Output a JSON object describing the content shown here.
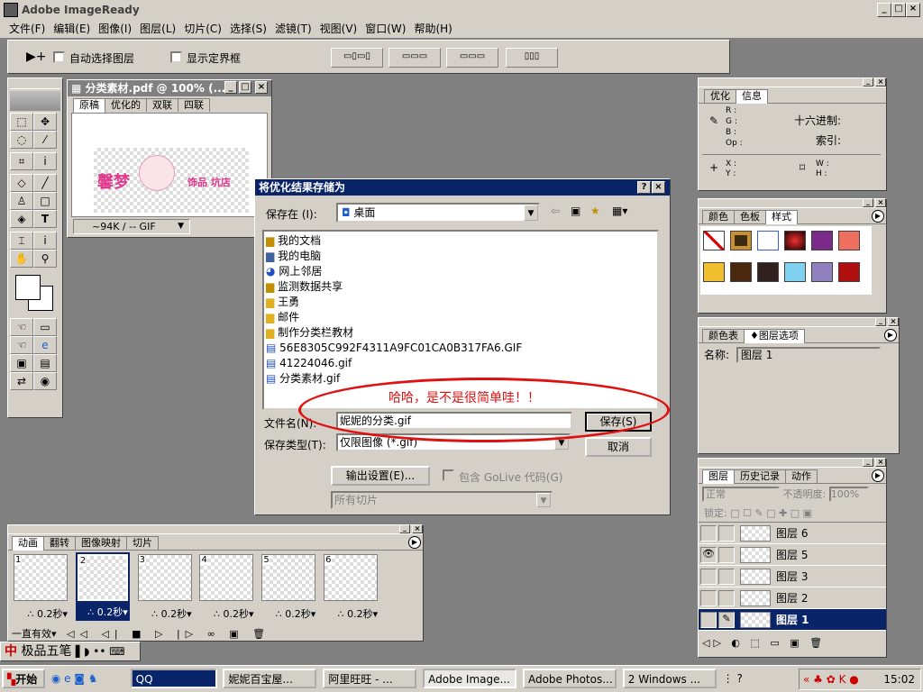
{
  "app": {
    "title": "Adobe ImageReady"
  },
  "menu": [
    "文件(F)",
    "编辑(E)",
    "图像(I)",
    "图层(L)",
    "切片(C)",
    "选择(S)",
    "滤镜(T)",
    "视图(V)",
    "窗口(W)",
    "帮助(H)"
  ],
  "options": {
    "auto_select": "自动选择图层",
    "show_bounds": "显示定界框"
  },
  "doc": {
    "title": "分类素材.pdf @ 100% (...",
    "tabs": [
      "原稿",
      "优化的",
      "双联",
      "四联"
    ],
    "status": "~94K / -- GIF",
    "logo_text": "馨梦",
    "logo_text2": "饰品 坑店"
  },
  "info_panel": {
    "tabs": [
      "优化",
      "信息"
    ],
    "hex_label": "十六进制:",
    "index_label": "索引:",
    "rgb": [
      "R :",
      "G :",
      "B :",
      "Op :"
    ],
    "xy": [
      "X :",
      "Y :"
    ],
    "wh": [
      "W :",
      "H :"
    ]
  },
  "color_panel": {
    "tabs": [
      "颜色",
      "色板",
      "样式"
    ]
  },
  "table_panel": {
    "tabs": [
      "颜色表",
      "图层选项"
    ],
    "name_label": "名称:",
    "name_value": "图层 1"
  },
  "layers_panel": {
    "tabs": [
      "图层",
      "历史记录",
      "动作"
    ],
    "blend": "正常",
    "opacity_label": "不透明度:",
    "opacity": "100%",
    "lock_label": "锁定:",
    "layers": [
      "图层 6",
      "图层 5",
      "图层 3",
      "图层 2",
      "图层 1"
    ]
  },
  "animation": {
    "tabs": [
      "动画",
      "翻转",
      "图像映射",
      "切片"
    ],
    "frames": [
      {
        "num": "1",
        "delay": "0.2秒"
      },
      {
        "num": "2",
        "delay": "0.2秒"
      },
      {
        "num": "3",
        "delay": "0.2秒"
      },
      {
        "num": "4",
        "delay": "0.2秒"
      },
      {
        "num": "5",
        "delay": "0.2秒"
      },
      {
        "num": "6",
        "delay": "0.2秒"
      }
    ],
    "loop": "一直有效"
  },
  "dialog": {
    "title": "将优化结果存储为",
    "save_in_label": "保存在 (I):",
    "save_in": "桌面",
    "items": [
      "我的文档",
      "我的电脑",
      "网上邻居",
      "监测数据共享",
      "王勇",
      "邮件",
      "制作分类栏教材",
      "56E8305C992F4311A9FC01CA0B317FA6.GIF",
      "41224046.gif",
      "分类素材.gif"
    ],
    "annotation": "哈哈，是不是很简单哇！！",
    "filename_label": "文件名(N):",
    "filename": "妮妮的分类.gif",
    "type_label": "保存类型(T):",
    "type": "仅限图像 (*.gif)",
    "save": "保存(S)",
    "cancel": "取消",
    "output_settings": "输出设置(E)...",
    "golive": "包含 GoLive 代码(G)",
    "slices": "所有切片"
  },
  "ime": {
    "label": "极品五笔"
  },
  "taskbar": {
    "start": "开始",
    "tasks": [
      "QQ",
      "妮妮百宝屋...",
      "阿里旺旺 - ...",
      "Adobe Image...",
      "Adobe Photos...",
      "2 Windows ..."
    ],
    "time": "15:02"
  }
}
